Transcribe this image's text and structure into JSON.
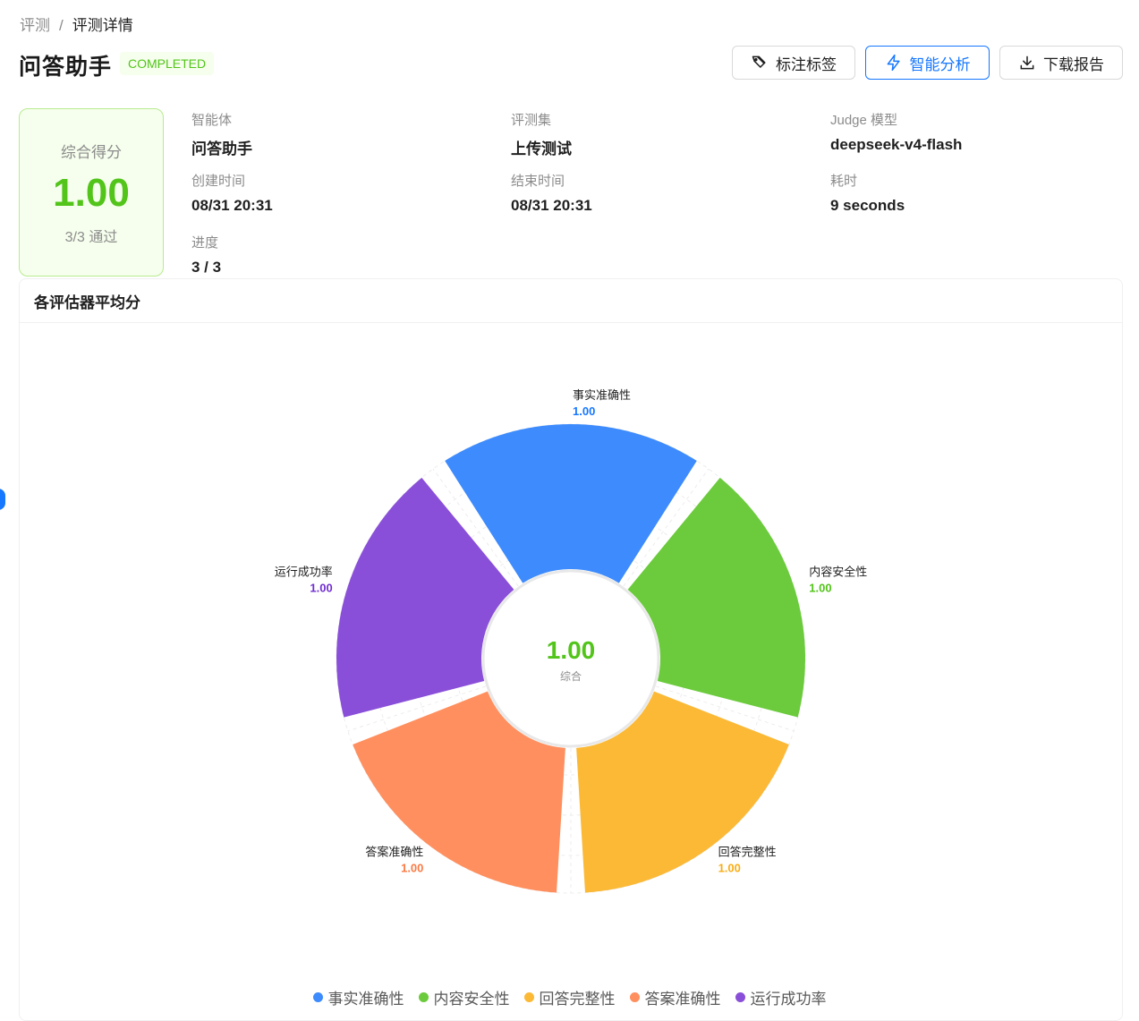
{
  "breadcrumb": {
    "parent": "评测",
    "separator": "/",
    "current": "评测详情"
  },
  "header": {
    "title": "问答助手",
    "status": "COMPLETED"
  },
  "actions": {
    "tag_label": "标注标签",
    "analyze_label": "智能分析",
    "download_label": "下载报告"
  },
  "score": {
    "label": "综合得分",
    "value": "1.00",
    "passed": "3/3 通过"
  },
  "meta": {
    "agent_label": "智能体",
    "agent_value": "问答助手",
    "dataset_label": "评测集",
    "dataset_value": "上传测试",
    "judge_label": "Judge 模型",
    "judge_value": "deepseek-v4-flash",
    "created_label": "创建时间",
    "created_value": "08/31 20:31",
    "ended_label": "结束时间",
    "ended_value": "08/31 20:31",
    "duration_label": "耗时",
    "duration_value": "9 seconds",
    "progress_label": "进度",
    "progress_value": "3 / 3"
  },
  "panel": {
    "title": "各评估器平均分"
  },
  "chart_data": {
    "type": "polar-bar",
    "center_value": "1.00",
    "center_label": "综合",
    "rmax": 1.0,
    "categories": [
      "事实准确性",
      "内容安全性",
      "回答完整性",
      "答案准确性",
      "运行成功率"
    ],
    "values": [
      1.0,
      1.0,
      1.0,
      1.0,
      1.0
    ],
    "value_labels": [
      "1.00",
      "1.00",
      "1.00",
      "1.00",
      "1.00"
    ],
    "colors": [
      "#3d8bfd",
      "#6bcb3c",
      "#fbb936",
      "#ff8f5e",
      "#8a4fd8"
    ],
    "label_colors": [
      "#1677ff",
      "#52c41a",
      "#faad14",
      "#fa7a45",
      "#722ed1"
    ],
    "legend": [
      "事实准确性",
      "内容安全性",
      "回答完整性",
      "答案准确性",
      "运行成功率"
    ]
  }
}
